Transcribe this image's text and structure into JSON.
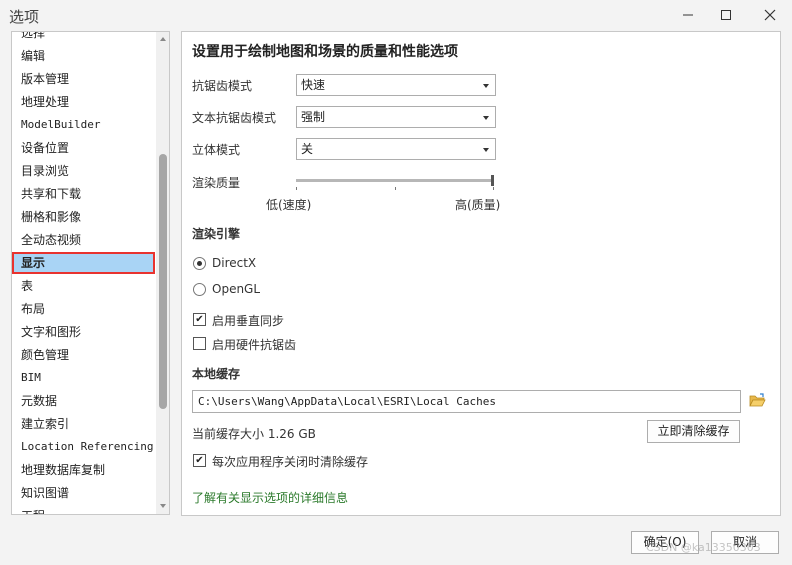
{
  "window": {
    "title": "选项"
  },
  "sidebar": {
    "items": [
      {
        "label": "选择",
        "mono": false
      },
      {
        "label": "编辑",
        "mono": false
      },
      {
        "label": "版本管理",
        "mono": false
      },
      {
        "label": "地理处理",
        "mono": false
      },
      {
        "label": "ModelBuilder",
        "mono": true
      },
      {
        "label": "设备位置",
        "mono": false
      },
      {
        "label": "目录浏览",
        "mono": false
      },
      {
        "label": "共享和下载",
        "mono": false
      },
      {
        "label": "栅格和影像",
        "mono": false
      },
      {
        "label": "全动态视频",
        "mono": false
      },
      {
        "label": "显示",
        "mono": false,
        "selected": true
      },
      {
        "label": "表",
        "mono": false
      },
      {
        "label": "布局",
        "mono": false
      },
      {
        "label": "文字和图形",
        "mono": false
      },
      {
        "label": "颜色管理",
        "mono": false
      },
      {
        "label": "BIM",
        "mono": true
      },
      {
        "label": "元数据",
        "mono": false
      },
      {
        "label": "建立索引",
        "mono": false
      },
      {
        "label": "Location Referencing",
        "mono": true
      },
      {
        "label": "地理数据库复制",
        "mono": false
      },
      {
        "label": "知识图谱",
        "mono": false
      },
      {
        "label": "工程",
        "mono": false
      }
    ]
  },
  "panel": {
    "heading": "设置用于绘制地图和场景的质量和性能选项",
    "antialias": {
      "label": "抗锯齿模式",
      "value": "快速"
    },
    "text_antialias": {
      "label": "文本抗锯齿模式",
      "value": "强制"
    },
    "stereo": {
      "label": "立体模式",
      "value": "关"
    },
    "render_quality": {
      "label": "渲染质量",
      "low": "低(速度)",
      "high": "高(质量)",
      "level": 1.0
    },
    "render_engine": {
      "title": "渲染引擎",
      "options": [
        {
          "label": "DirectX",
          "checked": true
        },
        {
          "label": "OpenGL",
          "checked": false
        }
      ]
    },
    "vsync": {
      "label": "启用垂直同步",
      "checked": true
    },
    "hw_antialias": {
      "label": "启用硬件抗锯齿",
      "checked": false
    },
    "cache": {
      "title": "本地缓存",
      "path": "C:\\Users\\Wang\\AppData\\Local\\ESRI\\Local Caches",
      "size_text": "当前缓存大小 1.26 GB",
      "clear_button": "立即清除缓存",
      "clear_on_close": {
        "label": "每次应用程序关闭时清除缓存",
        "checked": true
      }
    },
    "learn_more": "了解有关显示选项的详细信息"
  },
  "footer": {
    "ok": "确定(O)",
    "cancel": "取消"
  },
  "watermark": "CSDN @ka13350303",
  "colors": {
    "selection": "#a9d4f5",
    "highlight_border": "#e8332f",
    "link": "#2b7a2b"
  }
}
